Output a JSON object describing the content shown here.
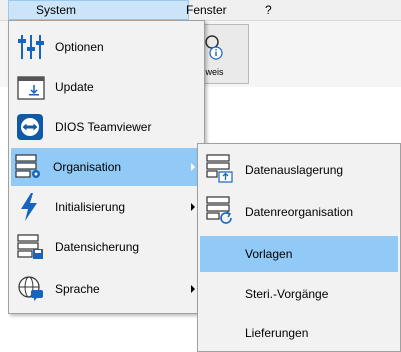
{
  "menubar": {
    "items": [
      "System",
      "Fenster",
      "?"
    ]
  },
  "toolbar": {
    "button_label": "chweis"
  },
  "main_menu": {
    "items": [
      {
        "label": "Optionen",
        "icon": "sliders-icon"
      },
      {
        "label": "Update",
        "icon": "update-window-icon"
      },
      {
        "label": "DIOS Teamviewer",
        "icon": "teamviewer-icon"
      },
      {
        "label": "Organisation",
        "icon": "server-gear-icon",
        "submenu": true,
        "highlighted": true
      },
      {
        "label": "Initialisierung",
        "icon": "lightning-icon",
        "submenu": true
      },
      {
        "label": "Datensicherung",
        "icon": "server-save-icon"
      },
      {
        "label": "Sprache",
        "icon": "globe-chat-icon",
        "submenu": true
      }
    ]
  },
  "sub_menu": {
    "items": [
      {
        "label": "Datenauslagerung",
        "icon": "server-export-icon"
      },
      {
        "label": "Datenreorganisation",
        "icon": "server-refresh-icon"
      },
      {
        "label": "Vorlagen",
        "highlighted": true
      },
      {
        "label": "Steri.-Vorgänge"
      },
      {
        "label": "Lieferungen"
      }
    ]
  },
  "colors": {
    "highlight": "#91c9f7",
    "accent_blue": "#1565c0",
    "menu_bg": "#f2f2f2"
  }
}
